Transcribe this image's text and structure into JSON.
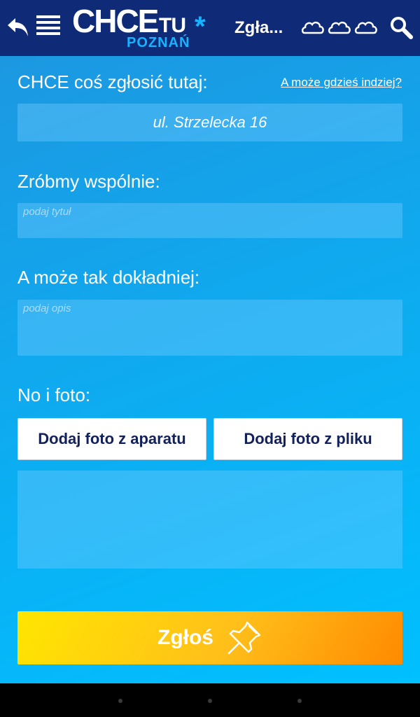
{
  "topbar": {
    "back_icon": "back-arrow-icon",
    "menu_icon": "hamburger-menu-icon",
    "logo_main": "CHCE",
    "logo_tu": "TU",
    "logo_star": "*",
    "logo_city": "POZNAŃ",
    "title": "Zgła...",
    "weather_icon": "cloud-icon",
    "search_icon": "search-icon"
  },
  "form": {
    "location_label": "CHCE coś zgłosić tutaj:",
    "location_link": "A może gdzieś indziej?",
    "address": "ul. Strzelecka 16",
    "title_label": "Zróbmy wspólnie:",
    "title_placeholder": "podaj tytuł",
    "description_label": "A może tak dokładniej:",
    "description_placeholder": "podaj opis",
    "photo_label": "No i foto:",
    "camera_button": "Dodaj foto z aparatu",
    "file_button": "Dodaj foto z pliku",
    "submit_button": "Zgłoś",
    "submit_icon": "pushpin-icon"
  },
  "colors": {
    "topbar": "#0f2b78",
    "background": "#10a8ee",
    "accent_blue": "#16b4ff",
    "button_text": "#13215a",
    "submit_start": "#ffe600",
    "submit_end": "#ff8a00"
  }
}
